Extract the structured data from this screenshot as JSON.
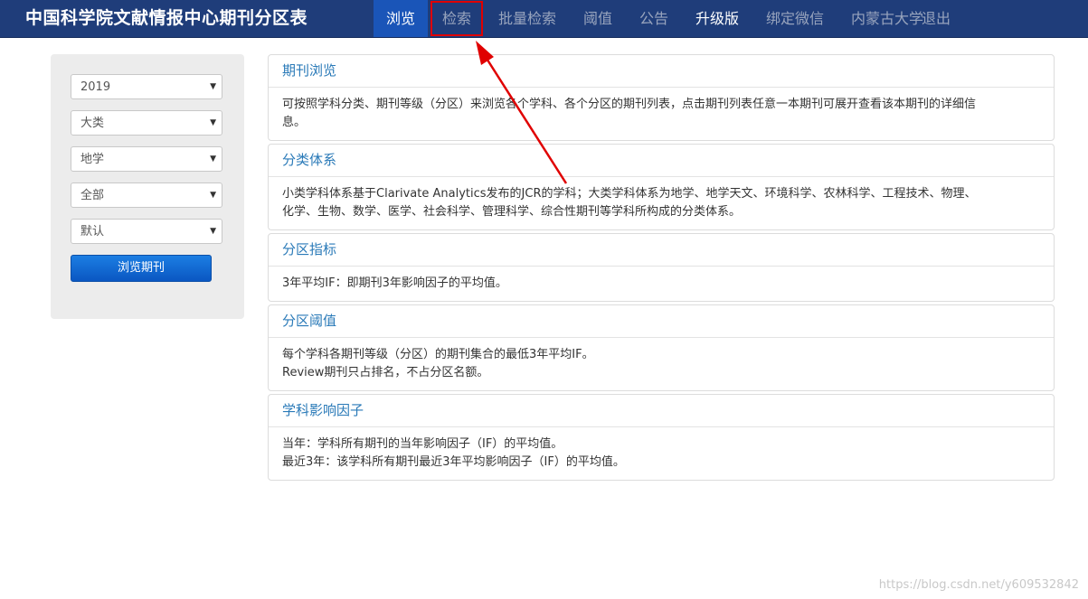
{
  "header": {
    "brand": "中国科学院文献情报中心期刊分区表",
    "nav": [
      {
        "label": "浏览"
      },
      {
        "label": "检索"
      },
      {
        "label": "批量检索"
      },
      {
        "label": "阈值"
      },
      {
        "label": "公告"
      },
      {
        "label": "升级版"
      },
      {
        "label": "绑定微信"
      },
      {
        "label": "内蒙古大学"
      },
      {
        "label": "退出"
      }
    ]
  },
  "sidebar": {
    "selects": [
      {
        "value": "2019"
      },
      {
        "value": "大类"
      },
      {
        "value": "地学"
      },
      {
        "value": "全部"
      },
      {
        "value": "默认"
      }
    ],
    "button_label": "浏览期刊"
  },
  "panels": [
    {
      "title": "期刊浏览",
      "lines": [
        "可按照学科分类、期刊等级（分区）来浏览各个学科、各个分区的期刊列表，点击期刊列表任意一本期刊可展开查看该本期刊的详细信",
        "息。"
      ]
    },
    {
      "title": "分类体系",
      "lines": [
        "小类学科体系基于Clarivate Analytics发布的JCR的学科；大类学科体系为地学、地学天文、环境科学、农林科学、工程技术、物理、",
        "化学、生物、数学、医学、社会科学、管理科学、综合性期刊等学科所构成的分类体系。"
      ]
    },
    {
      "title": "分区指标",
      "lines": [
        "3年平均IF：即期刊3年影响因子的平均值。"
      ]
    },
    {
      "title": "分区阈值",
      "lines": [
        "每个学科各期刊等级（分区）的期刊集合的最低3年平均IF。",
        "Review期刊只占排名，不占分区名额。"
      ]
    },
    {
      "title": "学科影响因子",
      "lines": [
        "当年：学科所有期刊的当年影响因子（IF）的平均值。",
        "最近3年：该学科所有期刊最近3年平均影响因子（IF）的平均值。"
      ]
    }
  ],
  "annotation": {
    "color": "#e00000"
  },
  "watermark": "https://blog.csdn.net/y609532842",
  "colors": {
    "navbar": "#1f3d7a",
    "active_tab": "#1a55b8",
    "panel_title": "#2a7ab8",
    "button": "#0a57c2"
  }
}
